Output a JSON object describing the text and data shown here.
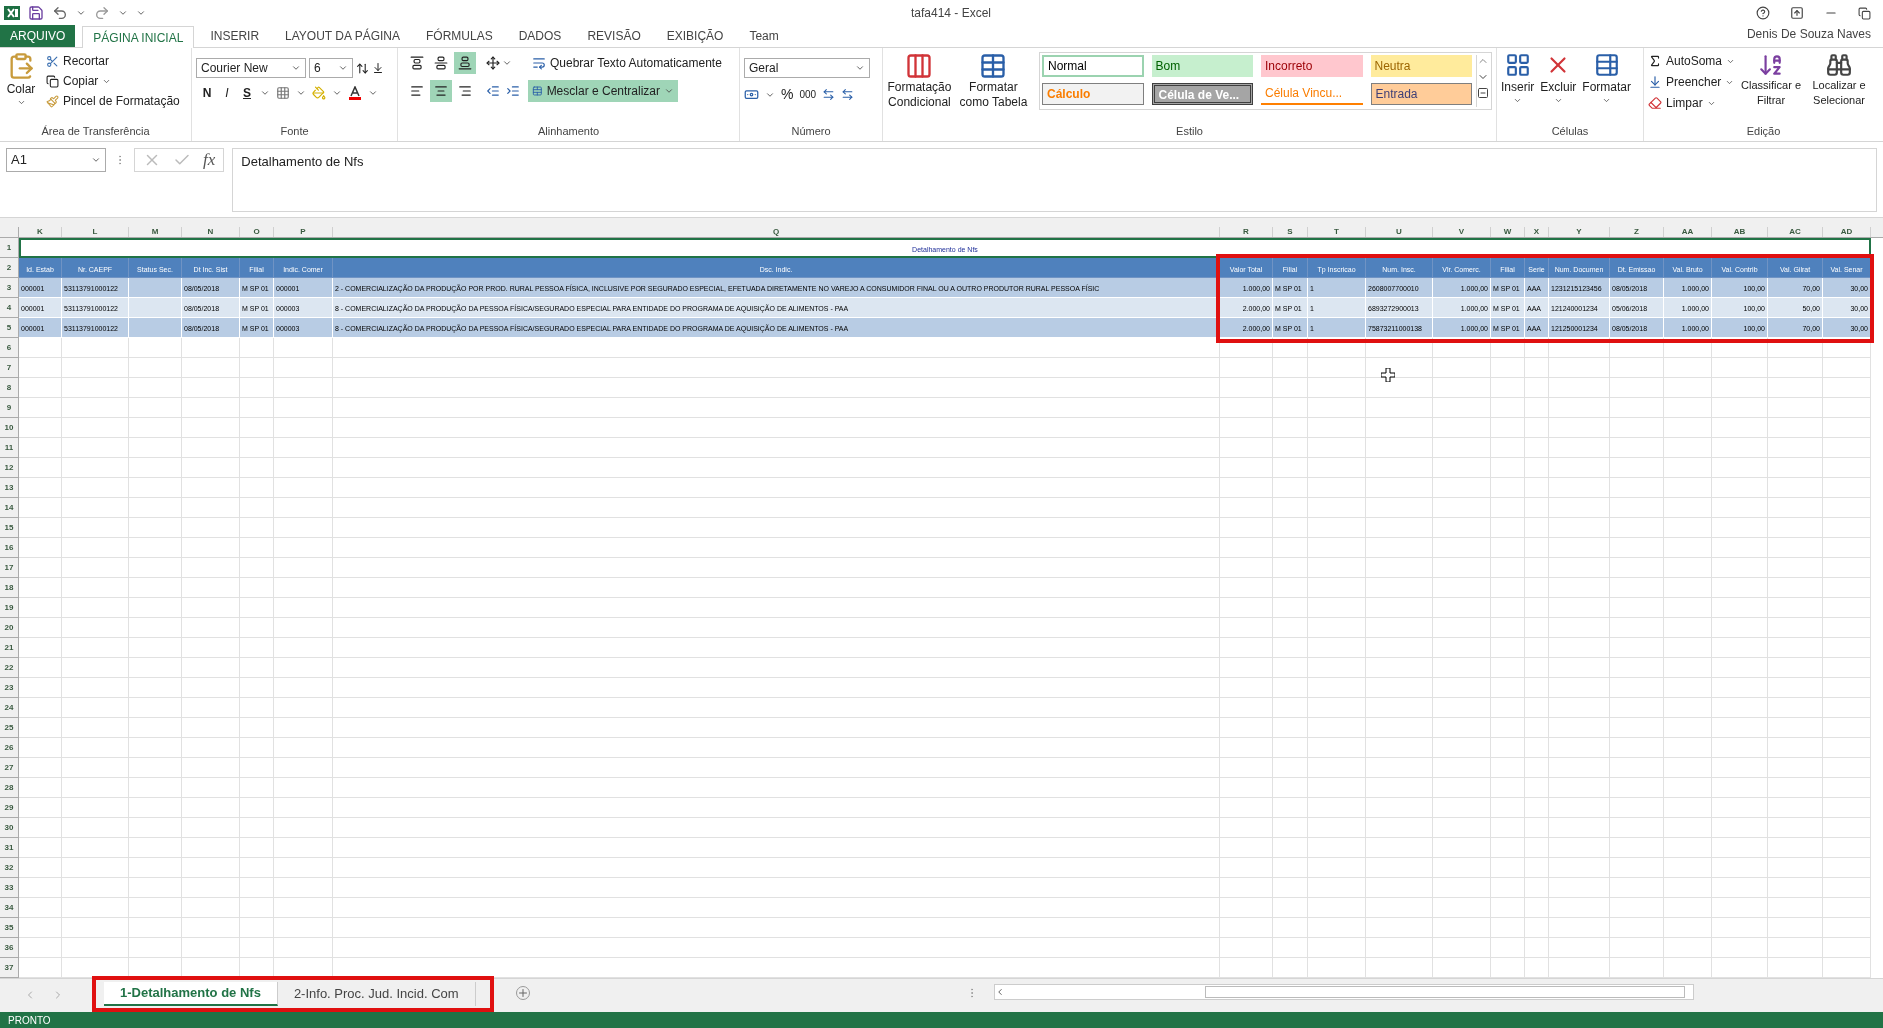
{
  "window": {
    "title": "tafa414 - Excel",
    "user": "Denis De Souza Naves"
  },
  "ribbon_tabs": [
    {
      "label": "ARQUIVO",
      "kind": "file",
      "selected": false
    },
    {
      "label": "PÁGINA INICIAL",
      "kind": "tab",
      "selected": true
    },
    {
      "label": "INSERIR",
      "kind": "tab",
      "selected": false
    },
    {
      "label": "LAYOUT DA PÁGINA",
      "kind": "tab",
      "selected": false
    },
    {
      "label": "FÓRMULAS",
      "kind": "tab",
      "selected": false
    },
    {
      "label": "DADOS",
      "kind": "tab",
      "selected": false
    },
    {
      "label": "REVISÃO",
      "kind": "tab",
      "selected": false
    },
    {
      "label": "EXIBIÇÃO",
      "kind": "tab",
      "selected": false
    },
    {
      "label": "Team",
      "kind": "tab",
      "selected": false
    }
  ],
  "clipboard": {
    "paste": "Colar",
    "cut": "Recortar",
    "copy": "Copiar",
    "format_painter": "Pincel de Formatação",
    "group": "Área de Transferência"
  },
  "font": {
    "name": "Courier New",
    "size": "6",
    "bold": "N",
    "italic": "I",
    "underline": "S",
    "group": "Fonte"
  },
  "alignment": {
    "vertical": [
      {
        "kind": "top",
        "selected": false
      },
      {
        "kind": "middle",
        "selected": false
      },
      {
        "kind": "bottom",
        "selected": true
      }
    ],
    "horizontal": [
      {
        "kind": "left",
        "selected": false
      },
      {
        "kind": "center",
        "selected": true
      },
      {
        "kind": "right",
        "selected": false
      }
    ],
    "wrap": "Quebrar Texto Automaticamente",
    "merge": {
      "label": "Mesclar e Centralizar",
      "on": true
    },
    "group": "Alinhamento"
  },
  "number": {
    "format": "Geral",
    "percent": "%",
    "thousands": "000",
    "group": "Número"
  },
  "styles": {
    "conditional": "Formatação Condicional",
    "table": "Formatar como Tabela",
    "gallery": [
      {
        "label": "Normal",
        "kind": "normal"
      },
      {
        "label": "Bom",
        "kind": "good"
      },
      {
        "label": "Incorreto",
        "kind": "bad"
      },
      {
        "label": "Neutra",
        "kind": "neutral"
      },
      {
        "label": "Cálculo",
        "kind": "calc"
      },
      {
        "label": "Célula de Ve...",
        "kind": "check"
      },
      {
        "label": "Célula Vincu...",
        "kind": "linked"
      },
      {
        "label": "Entrada",
        "kind": "input"
      }
    ],
    "group": "Estilo"
  },
  "cells": {
    "insert": "Inserir",
    "delete": "Excluir",
    "format": "Formatar",
    "group": "Células"
  },
  "editing": {
    "autosum": "AutoSoma",
    "fill": "Preencher",
    "clear": "Limpar",
    "sort": "Classificar e Filtrar",
    "find": "Localizar e Selecionar",
    "group": "Edição"
  },
  "formula_bar": {
    "name_box": "A1",
    "fx": "fx",
    "formula": "Detalhamento de Nfs"
  },
  "sheet": {
    "columns": [
      "K",
      "L",
      "M",
      "N",
      "O",
      "P",
      "Q",
      "R",
      "S",
      "T",
      "U",
      "V",
      "W",
      "X",
      "Y",
      "Z",
      "AA",
      "AB",
      "AC",
      "AD"
    ],
    "title_row": {
      "number": "1",
      "text": "Detalhamento de Nfs"
    },
    "header_row": {
      "number": "2",
      "cells": [
        "Id. Estab",
        "Nr. CAEPF",
        "Status Sec.",
        "Dt Inc. Sist",
        "Filial",
        "Indic. Comer",
        "Dsc. Indic.",
        "Valor Total",
        "Filial",
        "Tp Inscricao",
        "Num. Insc.",
        "Vlr. Comerc.",
        "Filial",
        "Serie",
        "Num. Documen",
        "Dt. Emissao",
        "Val. Bruto",
        "Val. Contrib",
        "Val. Gilrat",
        "Val. Senar"
      ]
    },
    "data_rows": [
      {
        "number": "3",
        "cells": [
          "000001",
          "53113791000122",
          null,
          "08/05/2018",
          "M SP 01",
          "000001",
          "2 - COMERCIALIZAÇÃO DA PRODUÇÃO POR PROD. RURAL PESSOA FÍSICA, INCLUSIVE POR SEGURADO ESPECIAL, EFETUADA DIRETAMENTE NO VAREJO A CONSUMIDOR FINAL OU A OUTRO PRODUTOR RURAL PESSOA FÍSIC",
          "1.000,00",
          "M SP 01",
          "1",
          "2608007700010",
          "1.000,00",
          "M SP 01",
          "AAA",
          "1231215123456",
          "08/05/2018",
          "1.000,00",
          "100,00",
          "70,00",
          "30,00"
        ]
      },
      {
        "number": "4",
        "cells": [
          "000001",
          "53113791000122",
          null,
          "08/05/2018",
          "M SP 01",
          "000003",
          "8 - COMERCIALIZAÇÃO DA PRODUÇÃO DA PESSOA FÍSICA/SEGURADO ESPECIAL PARA ENTIDADE DO PROGRAMA DE AQUISIÇÃO DE ALIMENTOS - PAA",
          "2.000,00",
          "M SP 01",
          "1",
          "6893272900013",
          "1.000,00",
          "M SP 01",
          "AAA",
          "121240001234",
          "05/06/2018",
          "1.000,00",
          "100,00",
          "50,00",
          "30,00"
        ]
      },
      {
        "number": "5",
        "cells": [
          "000001",
          "53113791000122",
          null,
          "08/05/2018",
          "M SP 01",
          "000003",
          "8 - COMERCIALIZAÇÃO DA PRODUÇÃO DA PESSOA FÍSICA/SEGURADO ESPECIAL PARA ENTIDADE DO PROGRAMA DE AQUISIÇÃO DE ALIMENTOS - PAA",
          "2.000,00",
          "M SP 01",
          "1",
          "75873211000138",
          "1.000,00",
          "M SP 01",
          "AAA",
          "121250001234",
          "08/05/2018",
          "1.000,00",
          "100,00",
          "70,00",
          "30,00"
        ]
      }
    ],
    "empty_rows": [
      "6",
      "7",
      "8",
      "9",
      "10",
      "11",
      "12",
      "13",
      "14",
      "15",
      "16",
      "17",
      "18",
      "19",
      "20",
      "21",
      "22",
      "23",
      "24",
      "25",
      "26",
      "27",
      "28",
      "29",
      "30",
      "31",
      "32",
      "33",
      "34",
      "35",
      "36",
      "37"
    ]
  },
  "sheet_tabs": [
    {
      "label": "1-Detalhamento de Nfs",
      "selected": true
    },
    {
      "label": "2-Info. Proc. Jud. Incid. Com",
      "selected": false
    }
  ],
  "status_bar": {
    "text": "PRONTO"
  }
}
